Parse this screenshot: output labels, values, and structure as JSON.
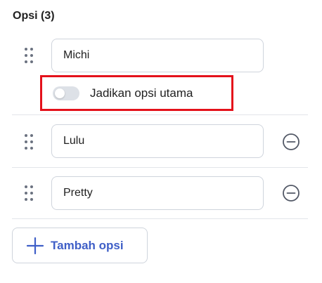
{
  "section": {
    "title": "Opsi (3)"
  },
  "options": [
    {
      "value": "Michi",
      "toggle_label": "Jadikan opsi utama",
      "is_primary": false
    },
    {
      "value": "Lulu"
    },
    {
      "value": "Pretty"
    }
  ],
  "add_button": {
    "label": "Tambah opsi"
  },
  "colors": {
    "accent": "#3f5fc7",
    "highlight_border": "#e4111b",
    "toggle_off": "#dde1e7",
    "border": "#cfd4dc"
  },
  "icons": {
    "drag": "drag-handle-icon",
    "remove": "minus-circle-icon",
    "add": "plus-icon"
  }
}
